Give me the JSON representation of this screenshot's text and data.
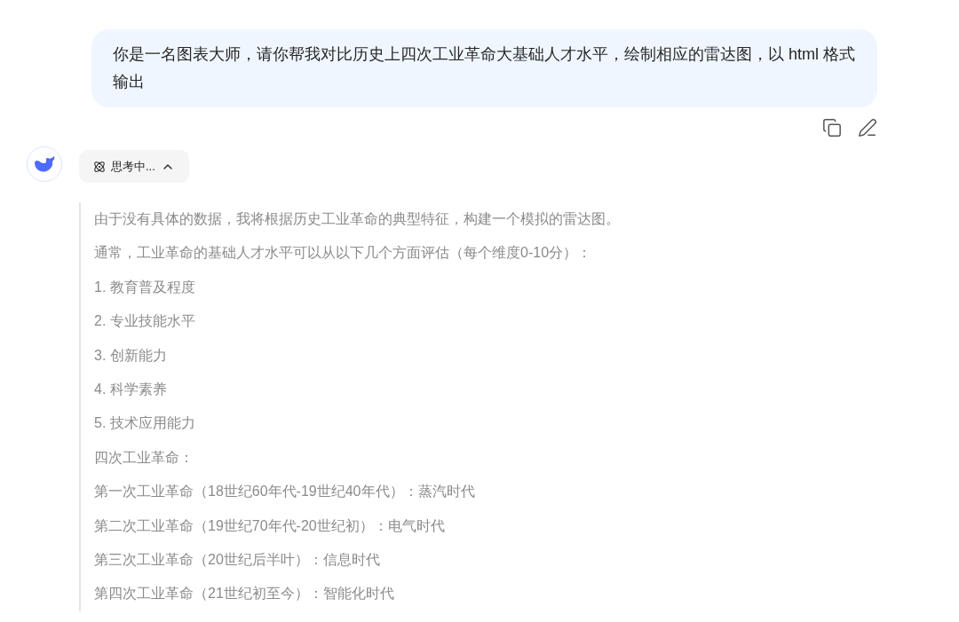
{
  "user_message": {
    "text": "你是一名图表大师，请你帮我对比历史上四次工业革命大基础人才水平，绘制相应的雷达图，以 html 格式输出"
  },
  "message_actions": [
    {
      "kind": "copy"
    },
    {
      "kind": "edit"
    }
  ],
  "assistant": {
    "thinking_toggle": {
      "label": "思考中...",
      "expanded": true
    },
    "thoughts": [
      {
        "text": "由于没有具体的数据，我将根据历史工业革命的典型特征，构建一个模拟的雷达图。"
      },
      {
        "text": "通常，工业革命的基础人才水平可以从以下几个方面评估（每个维度0-10分）："
      },
      {
        "text": "1. 教育普及程度"
      },
      {
        "text": "2. 专业技能水平"
      },
      {
        "text": "3. 创新能力"
      },
      {
        "text": "4. 科学素养"
      },
      {
        "text": "5. 技术应用能力"
      },
      {
        "text": "四次工业革命："
      },
      {
        "text": "第一次工业革命（18世纪60年代-19世纪40年代）：蒸汽时代"
      },
      {
        "text": "第二次工业革命（19世纪70年代-20世纪初）：电气时代"
      },
      {
        "text": "第三次工业革命（20世纪后半叶）：信息时代"
      },
      {
        "text": "第四次工业革命（21世纪初至今）：智能化时代"
      }
    ]
  }
}
